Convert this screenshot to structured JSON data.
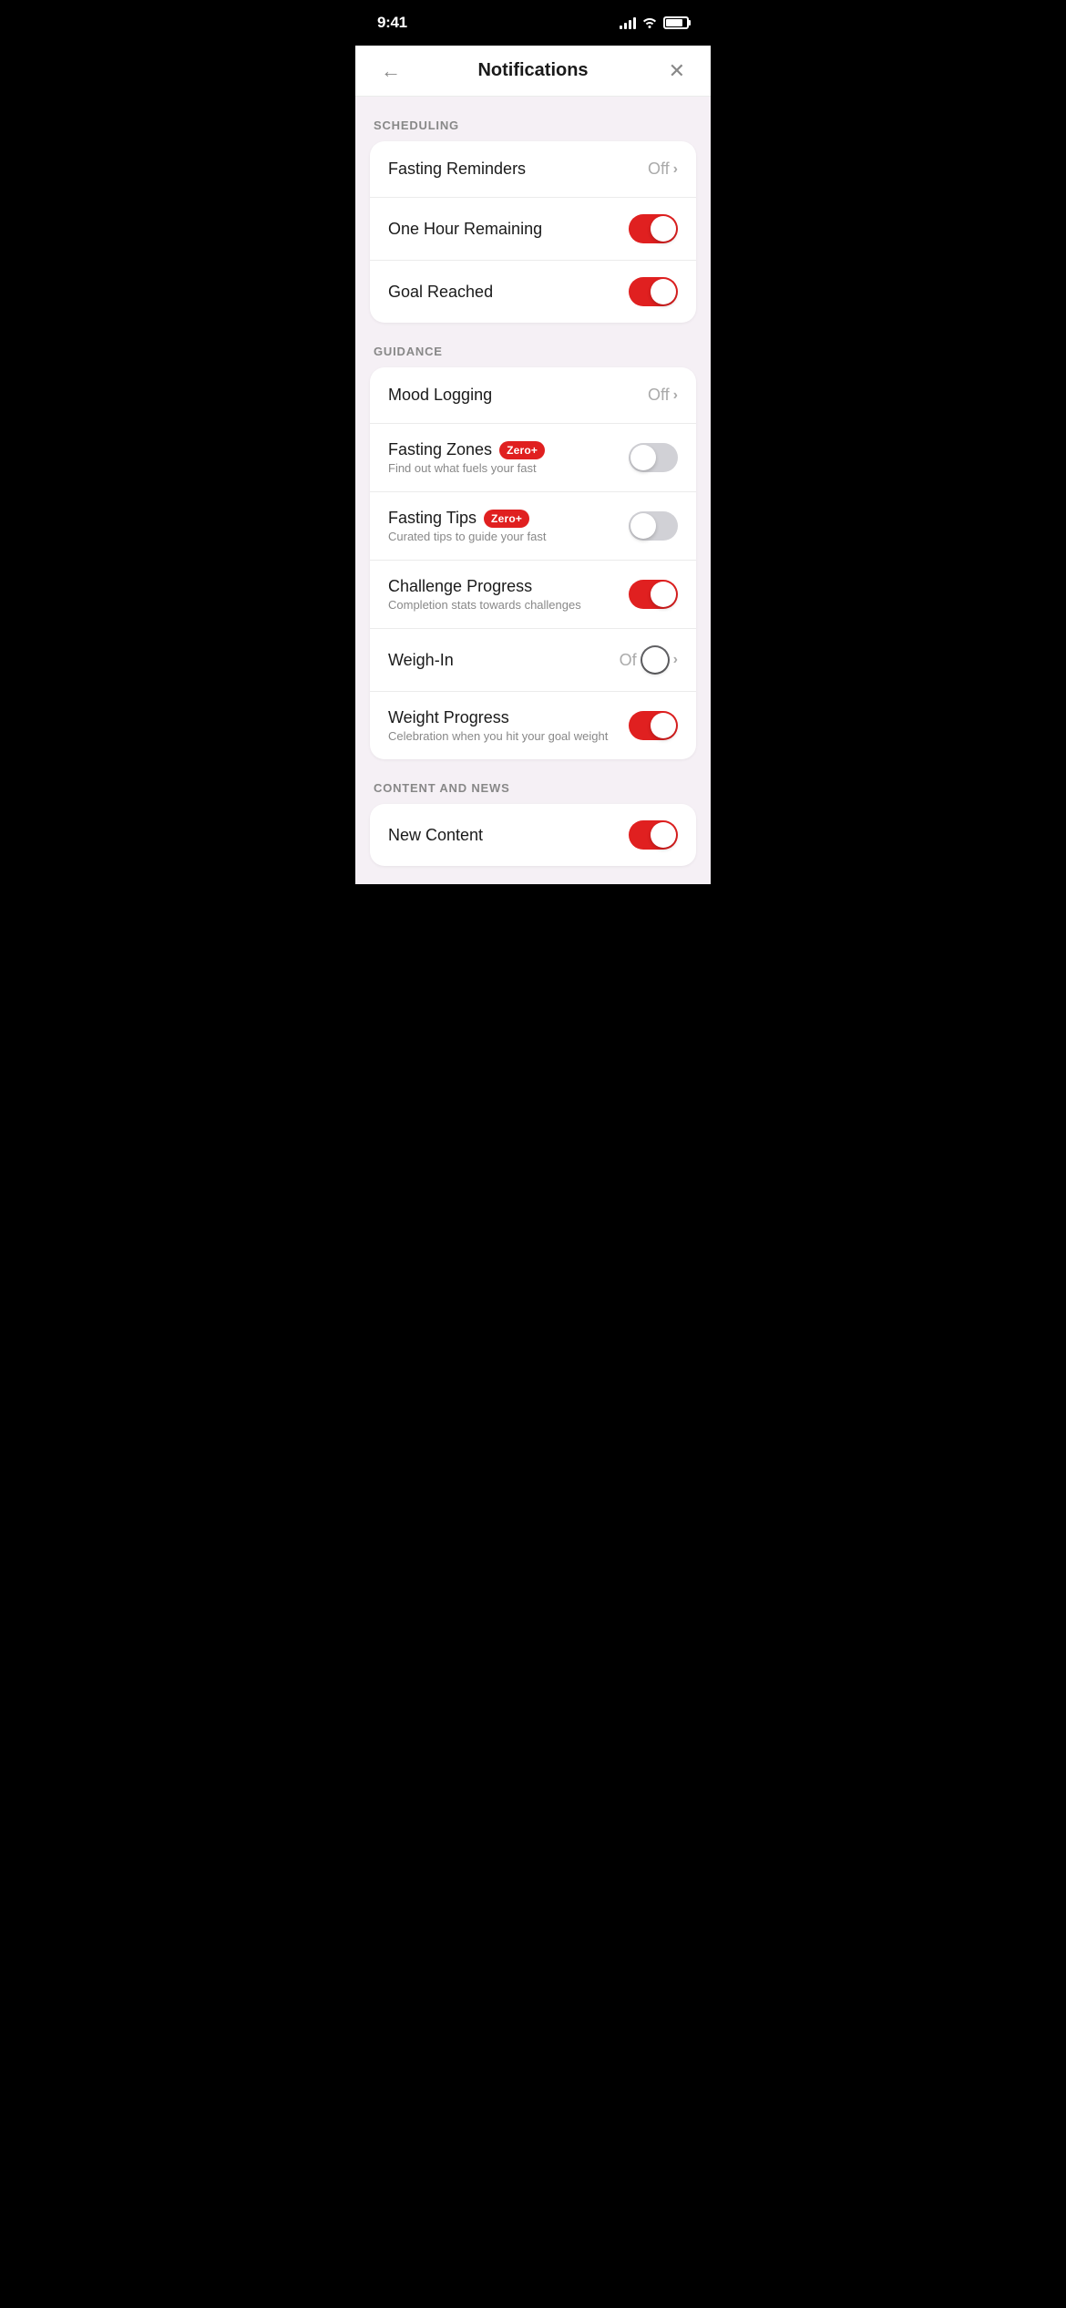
{
  "statusBar": {
    "time": "9:41"
  },
  "header": {
    "title": "Notifications",
    "backLabel": "←",
    "closeLabel": "✕"
  },
  "sections": [
    {
      "id": "scheduling",
      "label": "SCHEDULING",
      "items": [
        {
          "id": "fasting-reminders",
          "title": "Fasting Reminders",
          "subtitle": "",
          "badge": null,
          "controlType": "off-chevron",
          "controlValue": "Off",
          "toggleState": null
        },
        {
          "id": "one-hour-remaining",
          "title": "One Hour Remaining",
          "subtitle": "",
          "badge": null,
          "controlType": "toggle",
          "toggleState": "on"
        },
        {
          "id": "goal-reached",
          "title": "Goal Reached",
          "subtitle": "",
          "badge": null,
          "controlType": "toggle",
          "toggleState": "on"
        }
      ]
    },
    {
      "id": "guidance",
      "label": "GUIDANCE",
      "items": [
        {
          "id": "mood-logging",
          "title": "Mood Logging",
          "subtitle": "",
          "badge": null,
          "controlType": "off-chevron",
          "controlValue": "Off",
          "toggleState": null
        },
        {
          "id": "fasting-zones",
          "title": "Fasting Zones",
          "subtitle": "Find out what fuels your fast",
          "badge": "Zero+",
          "controlType": "toggle",
          "toggleState": "off"
        },
        {
          "id": "fasting-tips",
          "title": "Fasting Tips",
          "subtitle": "Curated tips to guide your fast",
          "badge": "Zero+",
          "controlType": "toggle",
          "toggleState": "off"
        },
        {
          "id": "challenge-progress",
          "title": "Challenge Progress",
          "subtitle": "Completion stats towards challenges",
          "badge": null,
          "controlType": "toggle",
          "toggleState": "on"
        },
        {
          "id": "weigh-in",
          "title": "Weigh-In",
          "subtitle": "",
          "badge": null,
          "controlType": "off-chevron-dark",
          "controlValue": "Of",
          "toggleState": null
        },
        {
          "id": "weight-progress",
          "title": "Weight Progress",
          "subtitle": "Celebration when you hit your goal weight",
          "badge": null,
          "controlType": "toggle",
          "toggleState": "on"
        }
      ]
    },
    {
      "id": "content-and-news",
      "label": "CONTENT AND NEWS",
      "items": [
        {
          "id": "new-content",
          "title": "New Content",
          "subtitle": "",
          "badge": null,
          "controlType": "toggle",
          "toggleState": "on"
        }
      ]
    }
  ]
}
